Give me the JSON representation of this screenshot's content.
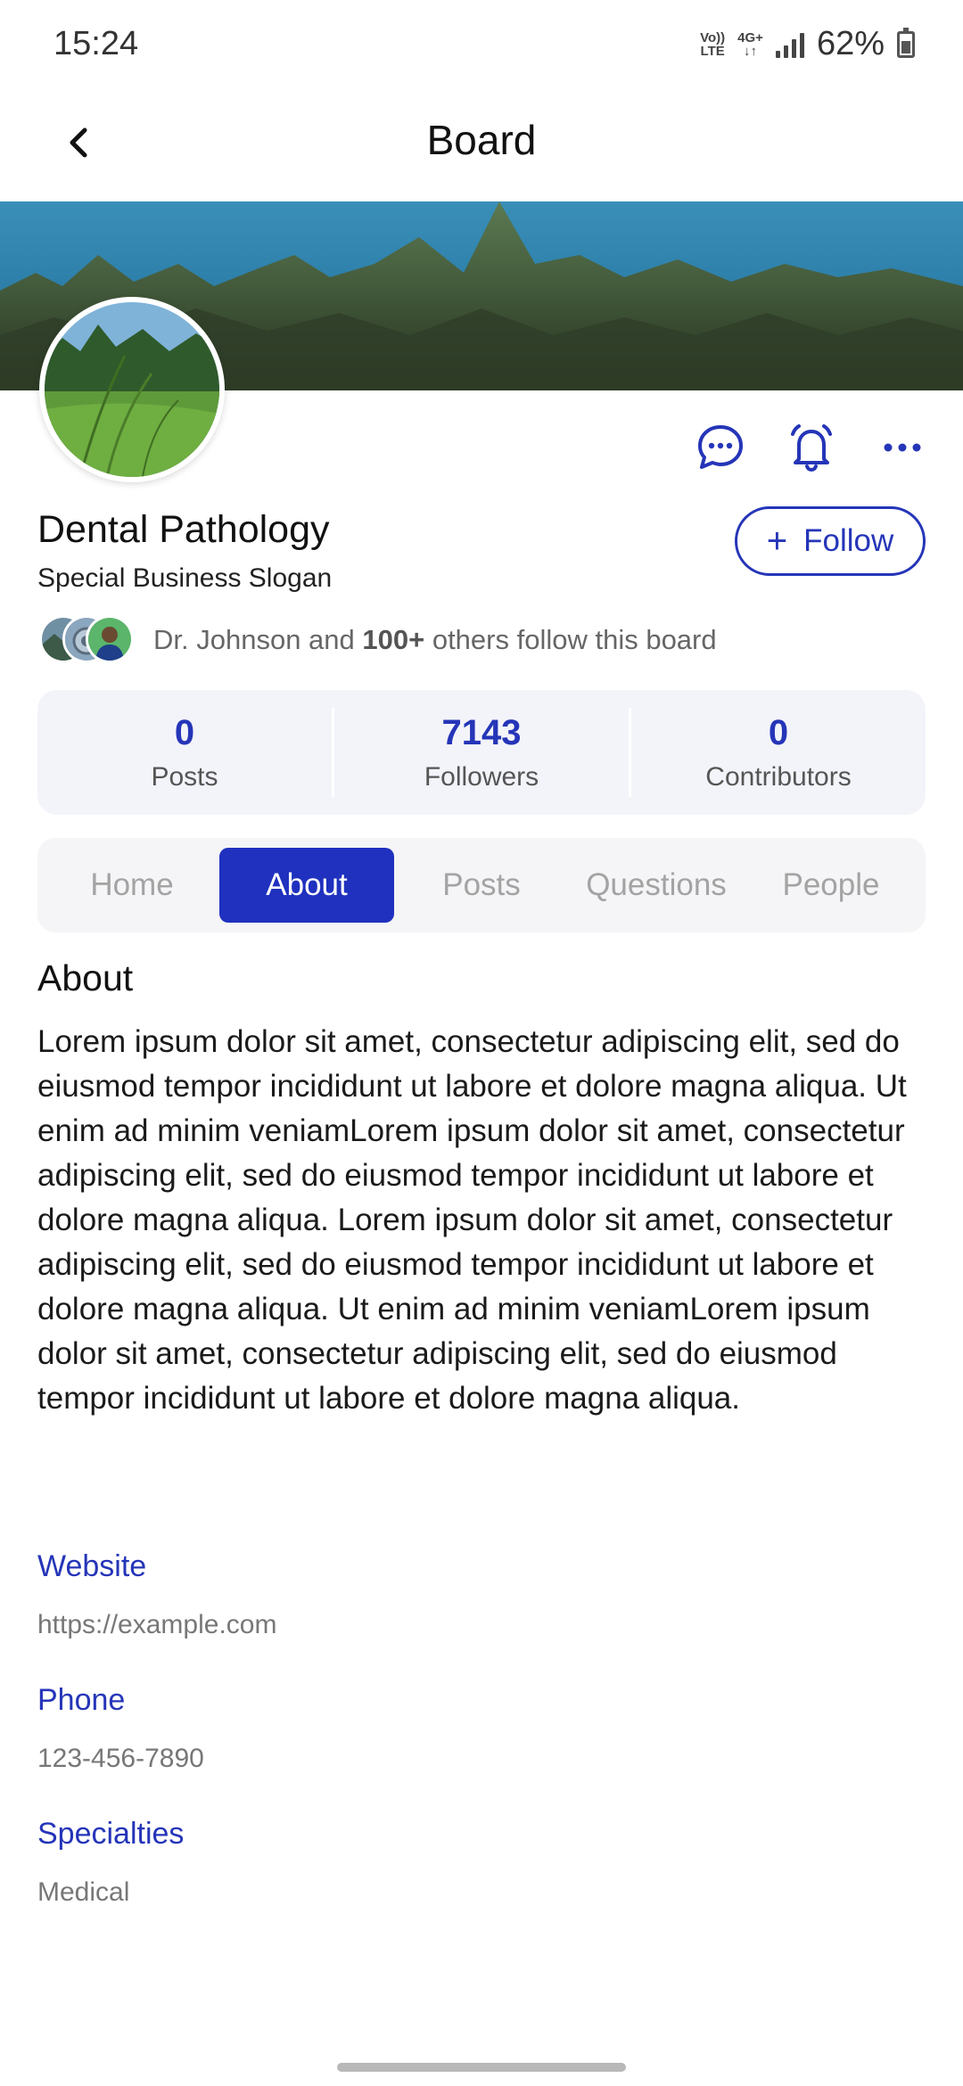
{
  "status_bar": {
    "time": "15:24",
    "network_top": "Vo))",
    "network_bottom": "LTE",
    "data_top": "4G+",
    "data_bottom": "↓↑",
    "battery": "62%"
  },
  "app_bar": {
    "title": "Board"
  },
  "profile": {
    "name": "Dental Pathology",
    "slogan": "Special Business Slogan",
    "follow_label": "Follow",
    "followers_pre": "Dr. Johnson and ",
    "followers_bold": "100+",
    "followers_post": " others follow this board"
  },
  "stats": [
    {
      "value": "0",
      "label": "Posts"
    },
    {
      "value": "7143",
      "label": "Followers"
    },
    {
      "value": "0",
      "label": "Contributors"
    }
  ],
  "tabs": [
    {
      "label": "Home",
      "active": false
    },
    {
      "label": "About",
      "active": true
    },
    {
      "label": "Posts",
      "active": false
    },
    {
      "label": "Questions",
      "active": false
    },
    {
      "label": "People",
      "active": false
    }
  ],
  "about": {
    "heading": "About",
    "body": "Lorem ipsum dolor sit amet, consectetur adipiscing elit, sed do eiusmod tempor incididunt ut labore et dolore magna aliqua. Ut enim ad minim veniamLorem ipsum dolor sit amet, consectetur adipiscing elit, sed do eiusmod tempor incididunt ut labore et dolore magna aliqua. Lorem ipsum dolor sit amet, consectetur adipiscing elit, sed do eiusmod tempor incididunt ut labore et dolore magna aliqua. Ut enim ad minim veniamLorem ipsum dolor sit amet, consectetur adipiscing elit, sed do eiusmod tempor incididunt ut labore et dolore magna aliqua.",
    "website_label": "Website",
    "website_value": "https://example.com",
    "phone_label": "Phone",
    "phone_value": "123-456-7890",
    "specialties_label": "Specialties",
    "specialties_value": "Medical"
  },
  "icons": {
    "back": "chevron-left-icon",
    "message": "chat-bubble-icon",
    "notify": "bell-icon",
    "more": "more-horizontal-icon",
    "follow": "plus-icon"
  },
  "colors": {
    "accent": "#2535b8",
    "tab_active": "#1f31be"
  }
}
